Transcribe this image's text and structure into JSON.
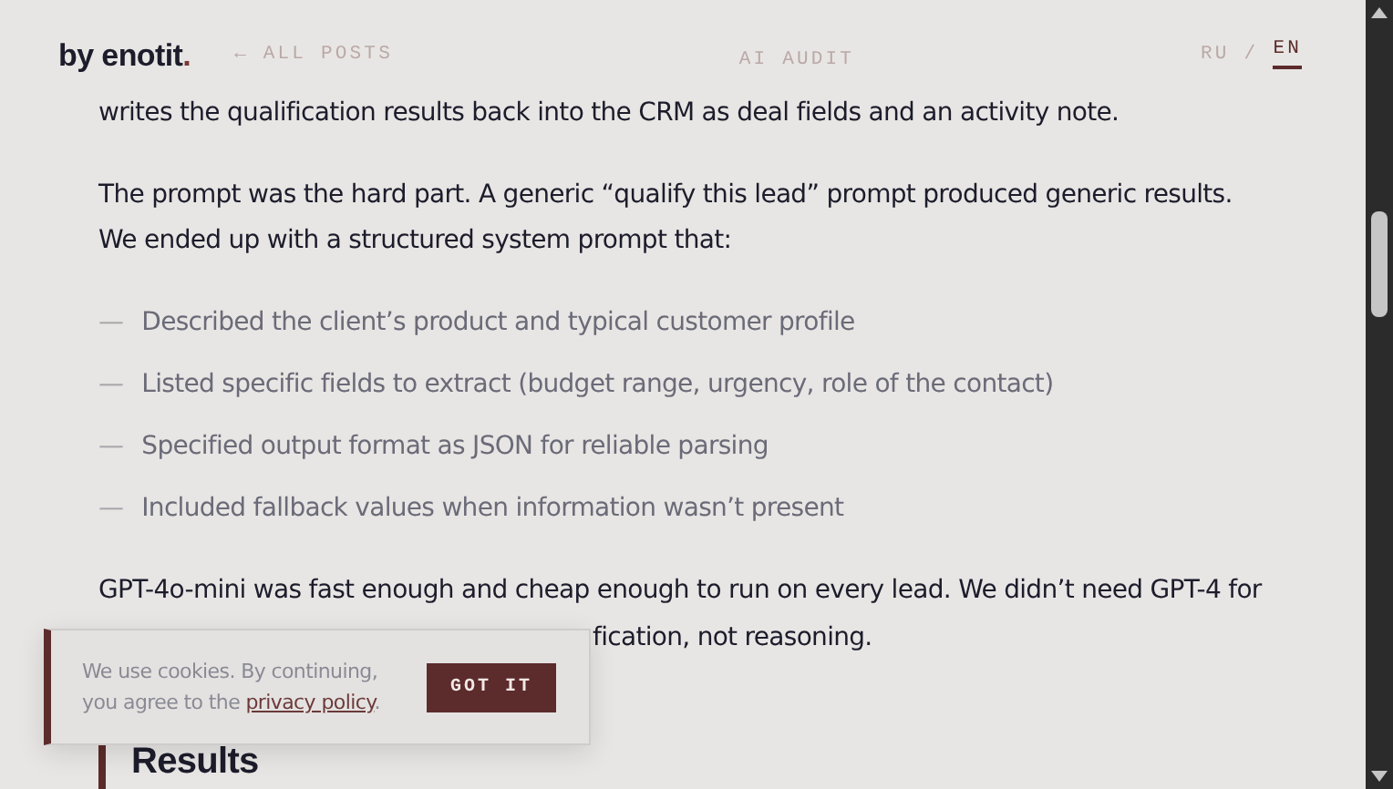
{
  "header": {
    "brand": "by enotit",
    "brand_dot": ".",
    "back_link": "← ALL POSTS",
    "section": "AI AUDIT",
    "languages": [
      {
        "label": "RU",
        "selected": false
      },
      {
        "label": "EN",
        "selected": true
      }
    ],
    "language_separator": "/"
  },
  "article": {
    "paragraphs": [
      {
        "lines": [
          "writes the qualification results back into the CRM as deal fields and an activity note."
        ]
      },
      {
        "lines": [
          "The prompt was the hard part. A generic “qualify this lead” prompt produced generic results.",
          "We ended up with a structured system prompt that:"
        ]
      }
    ],
    "list": [
      {
        "marker": "—",
        "text": "Described the client’s product and typical customer profile"
      },
      {
        "marker": "—",
        "text": "Listed specific fields to extract (budget range, urgency, role of the contact)"
      },
      {
        "marker": "—",
        "text": "Specified output format as JSON for reliable parsing"
      },
      {
        "marker": "—",
        "text": "Included fallback values when information wasn’t present"
      }
    ],
    "closing_paragraph": {
      "line_1": "GPT-4o-mini was fast enough and cheap enough to run on every lead. We didn’t need GPT-4 for",
      "line_2_visible": "fication, not reasoning."
    },
    "next_heading": "Results"
  },
  "cookie_banner": {
    "text": "We use cookies. By continuing, you agree to the ",
    "link": "privacy policy",
    "end": ".",
    "button": "GOT IT"
  }
}
